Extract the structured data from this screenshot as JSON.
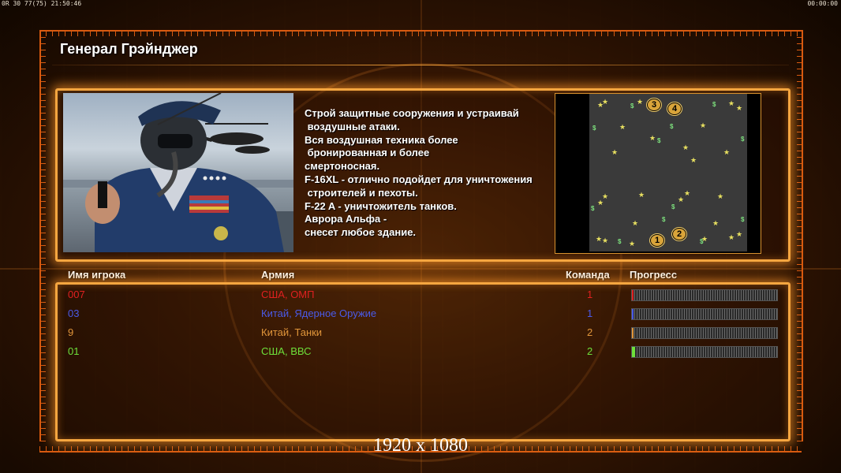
{
  "status_bar": {
    "left_text": "0R 30 77(75) 21:50:46",
    "right_text": "00:00:00"
  },
  "title": "Генерал Грэйнджер",
  "briefing_lines": [
    "Строй защитные сооружения и устраивай",
    " воздушные атаки.",
    "Вся воздушная техника более",
    " бронированная и более",
    "смертоносная.",
    "F-16XL - отлично подойдет для уничтожения",
    " строителей и пехоты.",
    "F-22 A - уничтожитель танков.",
    "Аврора Альфа -",
    "снесет любое здание."
  ],
  "minimap": {
    "spawn_labels": [
      "1",
      "2",
      "3",
      "4"
    ]
  },
  "table": {
    "headers": {
      "player": "Имя игрока",
      "army": "Армия",
      "team": "Команда",
      "progress": "Прогресс"
    },
    "rows": [
      {
        "name": "007",
        "army": "США, ОМП",
        "team": "1",
        "progress": 0.01,
        "color": "#e02020"
      },
      {
        "name": "03",
        "army": "Китай, Ядерное Оружие",
        "team": "1",
        "progress": 0.0,
        "color": "#4a5ae8"
      },
      {
        "name": "9",
        "army": "Китай, Танки",
        "team": "2",
        "progress": 0.01,
        "color": "#e0953a"
      },
      {
        "name": "01",
        "army": "США, ВВС",
        "team": "2",
        "progress": 0.02,
        "color": "#6ee03a"
      }
    ]
  },
  "resolution_label": "1920 x 1080",
  "colors": {
    "frame_orange": "#f5a640",
    "ruler_orange": "#d85a10"
  }
}
